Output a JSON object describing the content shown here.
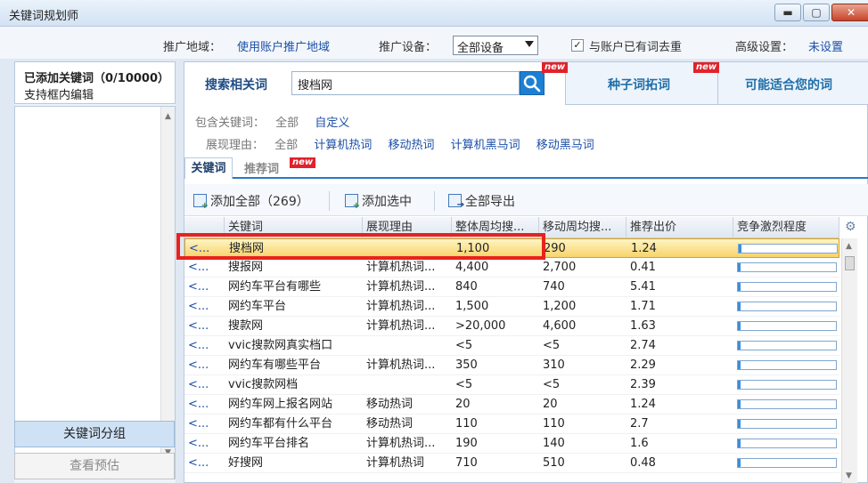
{
  "window": {
    "title": "关键词规划师",
    "minimize": "▬",
    "maximize": "▢",
    "close": "✕"
  },
  "settings": {
    "region_label": "推广地域：",
    "region_value": "使用账户推广地域",
    "device_label": "推广设备：",
    "device_value": "全部设备",
    "dedupe_label": "与账户已有词去重",
    "dedupe_checked": true,
    "advanced_label": "高级设置：",
    "advanced_value": "未设置"
  },
  "left": {
    "added_title": "已添加关键词（0/10000）",
    "hint": "支持框内编辑",
    "group_button": "关键词分组",
    "estimate_button": "查看预估"
  },
  "tabs": {
    "search_label": "搜索相关词",
    "search_value": "搜档网",
    "new_badge": "new",
    "seed_label": "种子词拓词",
    "suitable_label": "可能适合您的词"
  },
  "filters": {
    "include_label": "包含关键词：",
    "include_options": [
      "全部",
      "自定义"
    ],
    "reason_label": "展现理由：",
    "reason_options": [
      "全部",
      "计算机热词",
      "移动热词",
      "计算机黑马词",
      "移动黑马词"
    ]
  },
  "subtabs": {
    "keywords": "关键词",
    "recommended": "推荐词"
  },
  "toolbar": {
    "add_all": "添加全部（269）",
    "add_selected": "添加选中",
    "export_all": "全部导出"
  },
  "table": {
    "columns": [
      "",
      "关键词",
      "展现理由",
      "整体周均搜...",
      "移动周均搜...",
      "推荐出价",
      "竞争激烈程度"
    ],
    "rows": [
      {
        "add": "<...",
        "keyword": "搜档网",
        "reason": "",
        "weekly": "1,100",
        "mobile": "290",
        "bid": "1.24",
        "competition": 0.03,
        "selected": true
      },
      {
        "add": "<...",
        "keyword": "搜报网",
        "reason": "计算机热词...",
        "weekly": "4,400",
        "mobile": "2,700",
        "bid": "0.41",
        "competition": 0.03
      },
      {
        "add": "<...",
        "keyword": "网约车平台有哪些",
        "reason": "计算机热词...",
        "weekly": "840",
        "mobile": "740",
        "bid": "5.41",
        "competition": 0.03
      },
      {
        "add": "<...",
        "keyword": "网约车平台",
        "reason": "计算机热词...",
        "weekly": "1,500",
        "mobile": "1,200",
        "bid": "1.71",
        "competition": 0.03
      },
      {
        "add": "<...",
        "keyword": "搜款网",
        "reason": "计算机热词...",
        "weekly": ">20,000",
        "mobile": "4,600",
        "bid": "1.63",
        "competition": 0.03
      },
      {
        "add": "<...",
        "keyword": "vvic搜款网真实档口",
        "reason": "",
        "weekly": "<5",
        "mobile": "<5",
        "bid": "2.74",
        "competition": 0.03
      },
      {
        "add": "<...",
        "keyword": "网约车有哪些平台",
        "reason": "计算机热词...",
        "weekly": "350",
        "mobile": "310",
        "bid": "2.29",
        "competition": 0.03
      },
      {
        "add": "<...",
        "keyword": "vvic搜款网档",
        "reason": "",
        "weekly": "<5",
        "mobile": "<5",
        "bid": "2.39",
        "competition": 0.03
      },
      {
        "add": "<...",
        "keyword": "网约车网上报名网站",
        "reason": "移动热词",
        "weekly": "20",
        "mobile": "20",
        "bid": "1.24",
        "competition": 0.03
      },
      {
        "add": "<...",
        "keyword": "网约车都有什么平台",
        "reason": "移动热词",
        "weekly": "110",
        "mobile": "110",
        "bid": "2.7",
        "competition": 0.03
      },
      {
        "add": "<...",
        "keyword": "网约车平台排名",
        "reason": "计算机热词...",
        "weekly": "190",
        "mobile": "140",
        "bid": "1.6",
        "competition": 0.03
      },
      {
        "add": "<...",
        "keyword": "好搜网",
        "reason": "计算机热词",
        "weekly": "710",
        "mobile": "510",
        "bid": "0.48",
        "competition": 0.03
      }
    ]
  },
  "colors": {
    "accent": "#1d7fd3",
    "link": "#1c4fa8",
    "highlight": "#e8221f",
    "selected_row": "#f7d46b"
  }
}
